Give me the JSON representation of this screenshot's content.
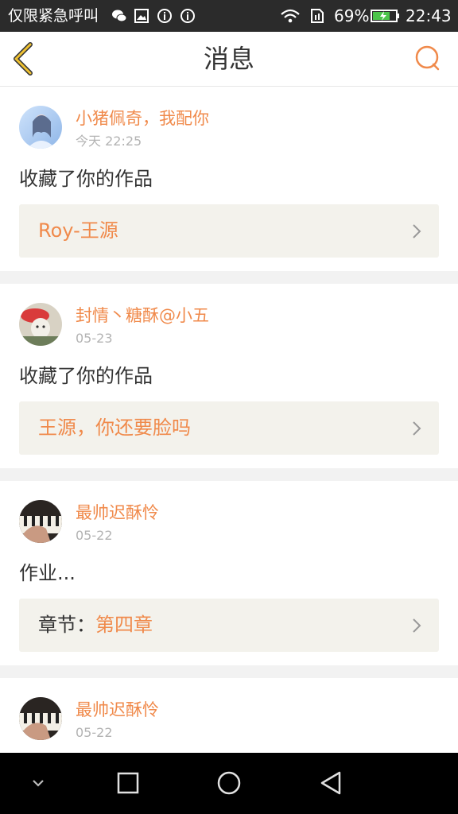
{
  "status_bar": {
    "carrier": "仅限紧急呼叫",
    "battery_percent": "69%",
    "time": "22:43"
  },
  "header": {
    "title": "消息"
  },
  "colors": {
    "accent": "#f08a4b",
    "text": "#333333",
    "muted": "#b3b3b3",
    "card_link_bg": "#f3f2ec"
  },
  "messages": [
    {
      "username": "小猪佩奇，我配你",
      "time": "今天 22:25",
      "action": "收藏了你的作品",
      "work_prefix": "",
      "work_title": "Roy-王源"
    },
    {
      "username": "封情丶糖酥@小五",
      "time": "05-23",
      "action": "收藏了你的作品",
      "work_prefix": "",
      "work_title": "王源，你还要脸吗"
    },
    {
      "username": "最帅迟酥怜",
      "time": "05-22",
      "action": "作业...",
      "work_prefix": "章节：",
      "work_title": "第四章"
    },
    {
      "username": "最帅迟酥怜",
      "time": "05-22",
      "action": "",
      "work_prefix": "",
      "work_title": ""
    }
  ],
  "icons": {
    "back": "chevron-left-icon",
    "chat": "chat-bubble-icon",
    "nav_collapse": "chevron-down-icon",
    "nav_recent": "square-icon",
    "nav_home": "circle-icon",
    "nav_back": "triangle-back-icon"
  }
}
